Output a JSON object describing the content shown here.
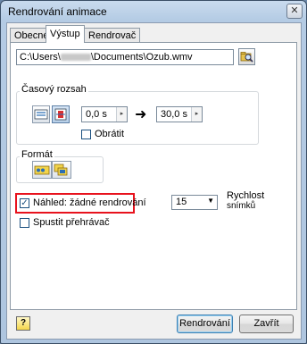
{
  "window": {
    "title": "Rendrování animace",
    "close_glyph": "✕"
  },
  "tabs": [
    {
      "label": "Obecné",
      "active": false
    },
    {
      "label": "Výstup",
      "active": true
    },
    {
      "label": "Rendrovač",
      "active": false
    }
  ],
  "output": {
    "path_prefix": "C:\\Users\\",
    "path_suffix": "\\Documents\\Ozub.wmv",
    "browse_icon": "folder-search-icon"
  },
  "time_range": {
    "label": "Časový rozsah",
    "start": "0,0 s",
    "end": "30,0 s",
    "arrow": "➜",
    "spin_glyph": "▸",
    "reverse_label": "Obrátit",
    "reverse_checked": false
  },
  "format": {
    "label": "Formát"
  },
  "preview": {
    "label": "Náhled: žádné rendrování",
    "checked": true,
    "check_glyph": "✓",
    "highlight_color": "#e8121d"
  },
  "launch_player": {
    "label": "Spustit přehrávač",
    "checked": false
  },
  "frame_rate": {
    "value": "15",
    "chevron": "▼",
    "label_line1": "Rychlost",
    "label_line2": "snímků"
  },
  "footer": {
    "help_glyph": "?",
    "render_label": "Rendrování",
    "close_label": "Zavřít"
  }
}
